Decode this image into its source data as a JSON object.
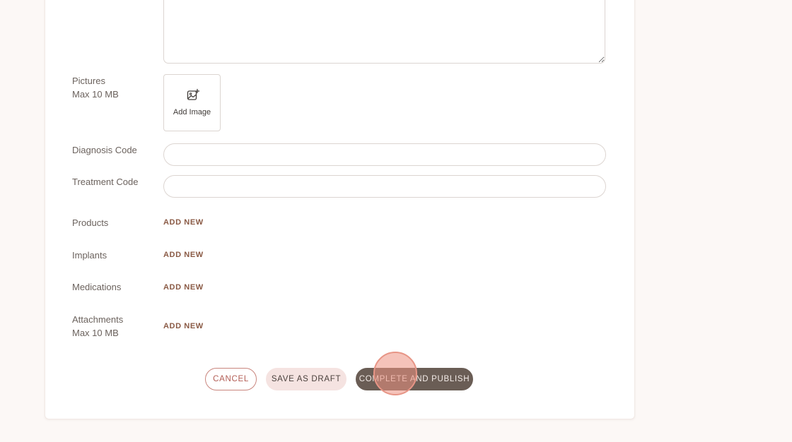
{
  "form": {
    "pictures": {
      "label": "Pictures",
      "sub_label": "Max 10 MB",
      "add_image_label": "Add Image",
      "icon": "image-plus-icon"
    },
    "diagnosis_code": {
      "label": "Diagnosis Code",
      "value": "",
      "placeholder": ""
    },
    "treatment_code": {
      "label": "Treatment Code",
      "value": "",
      "placeholder": ""
    },
    "products": {
      "label": "Products",
      "action": "ADD NEW"
    },
    "implants": {
      "label": "Implants",
      "action": "ADD NEW"
    },
    "medications": {
      "label": "Medications",
      "action": "ADD NEW"
    },
    "attachments": {
      "label": "Attachments",
      "sub_label": "Max 10 MB",
      "action": "ADD NEW"
    }
  },
  "actions": {
    "cancel": "CANCEL",
    "save_draft": "SAVE AS DRAFT",
    "publish": "COMPLETE AND PUBLISH"
  },
  "colors": {
    "page_background": "#fcf8f6",
    "accent_link": "#8a5a45",
    "cancel_border": "#c9857d",
    "draft_background": "#f5e3e1",
    "publish_background": "#6a5d55",
    "click_indicator": "#ec9282"
  }
}
